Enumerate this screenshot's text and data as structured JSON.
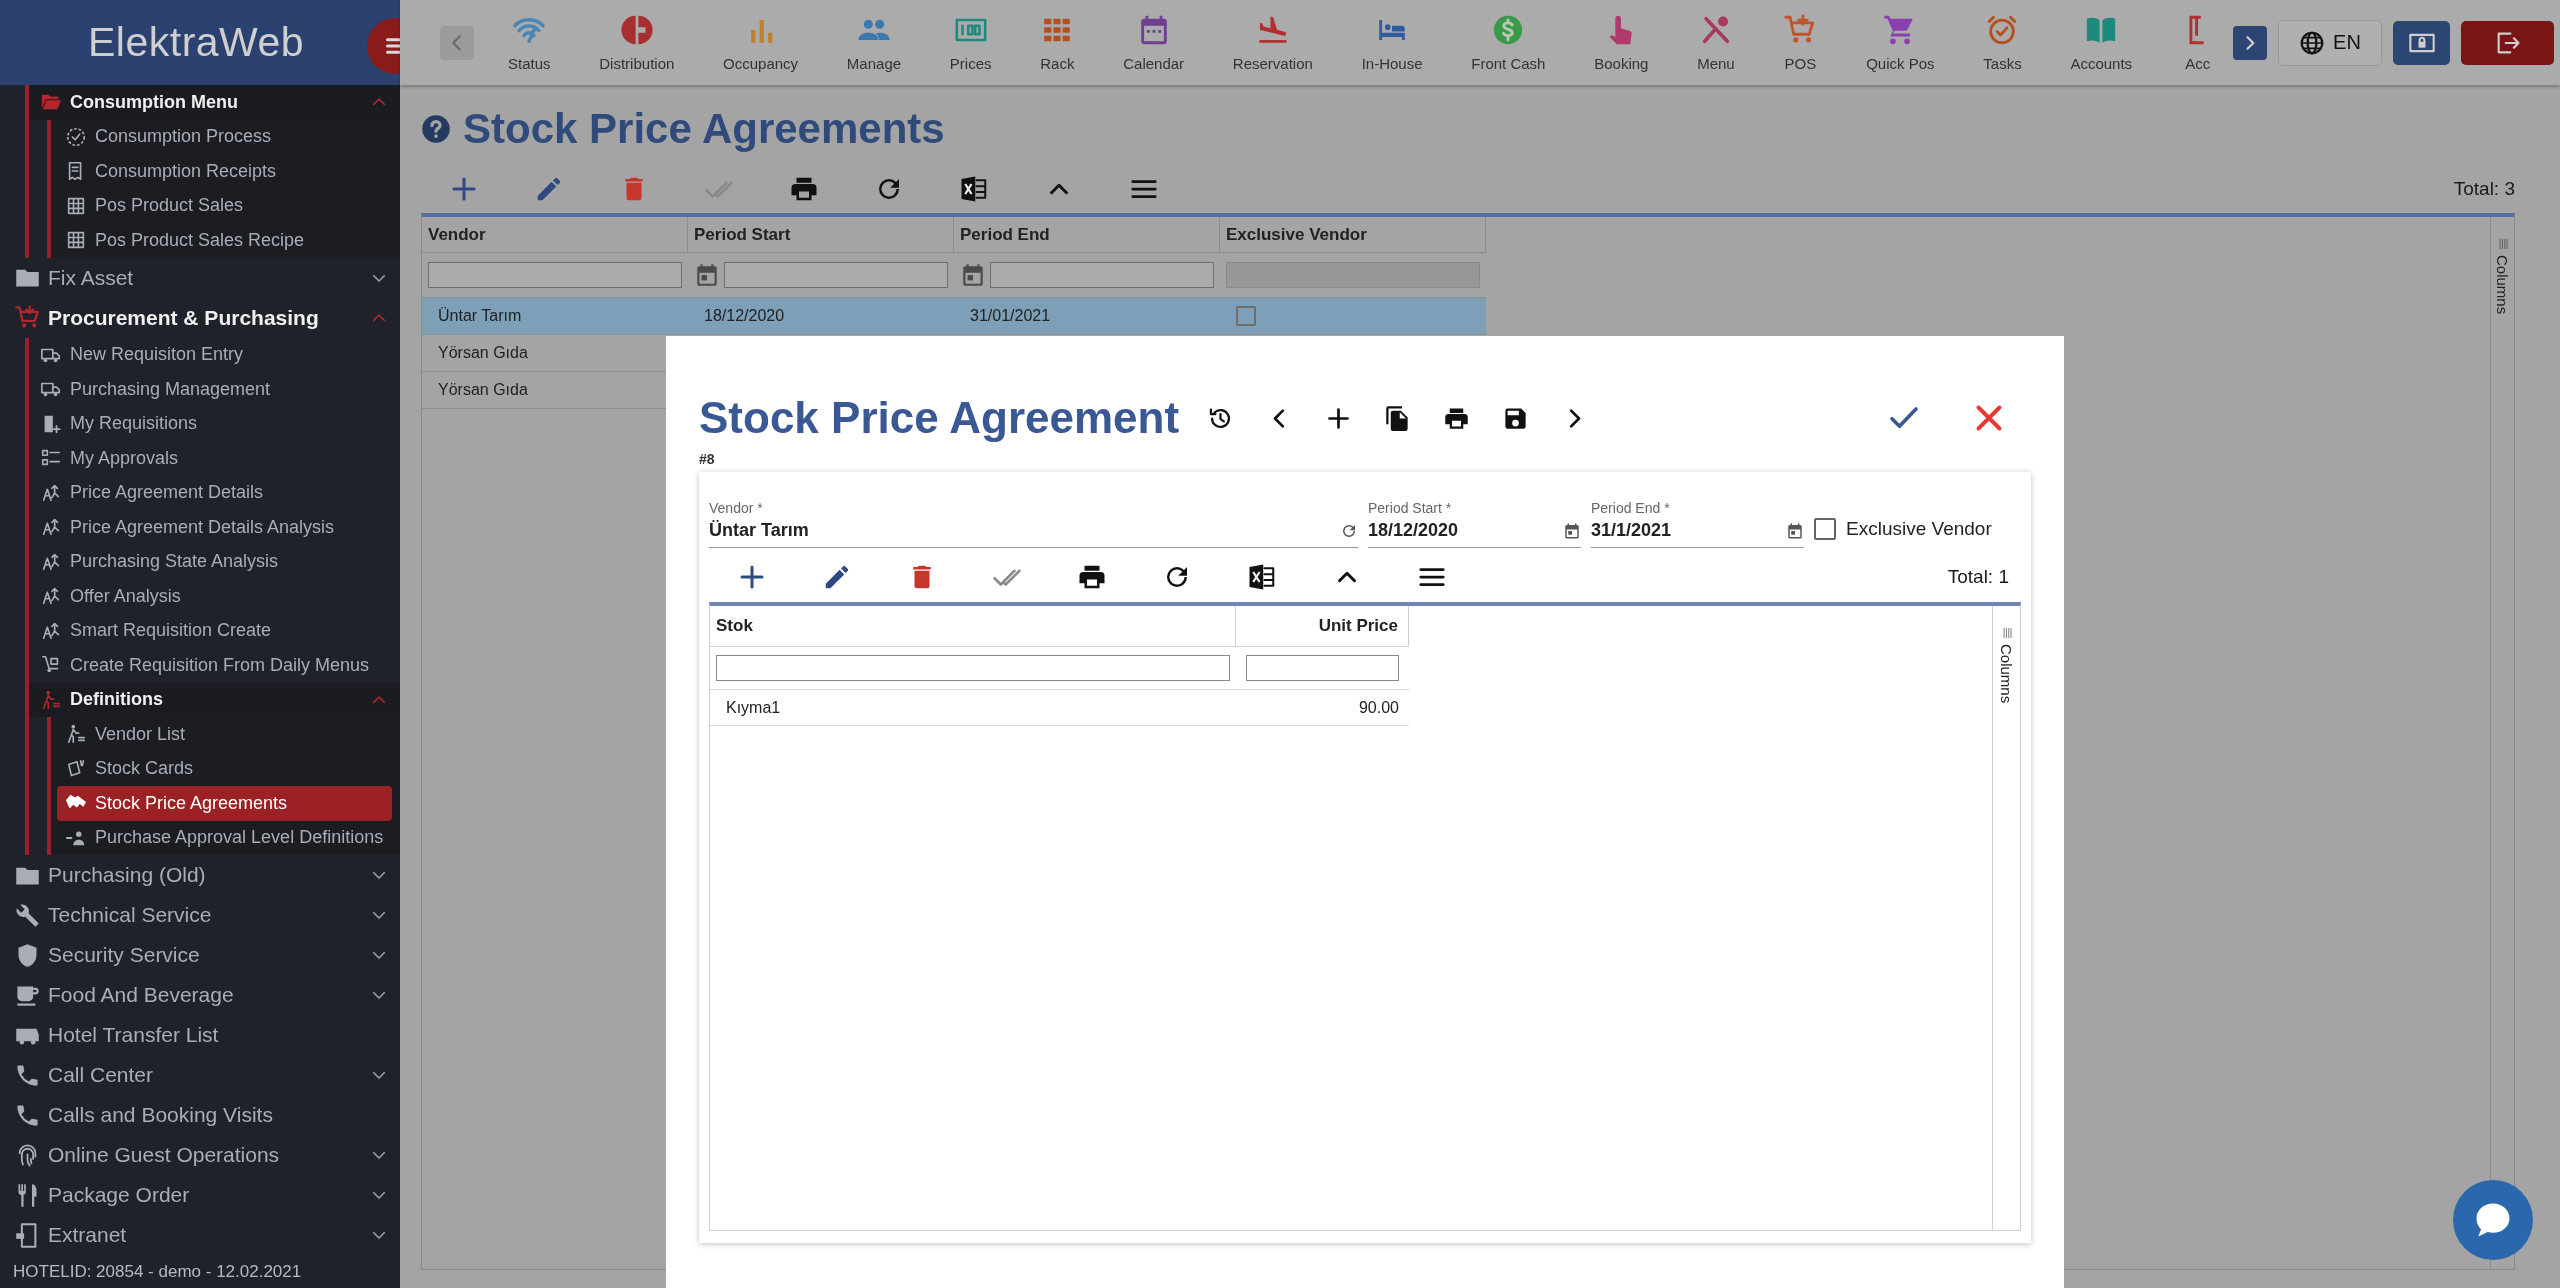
{
  "sidebar": {
    "logo": "ElektraWeb",
    "continued_items": [
      {
        "label": "Consumption Menu",
        "kind": "group",
        "expanded": true,
        "children": [
          {
            "label": "Consumption Process",
            "kind": "link",
            "selected": false
          },
          {
            "label": "Consumption Receipts",
            "kind": "link",
            "selected": false
          },
          {
            "label": "Pos Product Sales",
            "kind": "link",
            "selected": false
          },
          {
            "label": "Pos Product Sales Recipe",
            "kind": "link",
            "selected": false
          }
        ]
      }
    ],
    "items": [
      {
        "label": "Fix Asset",
        "kind": "group",
        "expanded": false
      },
      {
        "label": "Procurement & Purchasing",
        "kind": "group",
        "expanded": true,
        "children": [
          {
            "label": "New Requisiton Entry",
            "kind": "link",
            "selected": false
          },
          {
            "label": "Purchasing Management",
            "kind": "link",
            "selected": false
          },
          {
            "label": "My Requisitions",
            "kind": "link",
            "selected": false
          },
          {
            "label": "My Approvals",
            "kind": "link",
            "selected": false
          },
          {
            "label": "Price Agreement Details",
            "kind": "link",
            "selected": false
          },
          {
            "label": "Price Agreement Details Analysis",
            "kind": "link",
            "selected": false
          },
          {
            "label": "Purchasing State Analysis",
            "kind": "link",
            "selected": false
          },
          {
            "label": "Offer Analysis",
            "kind": "link",
            "selected": false
          },
          {
            "label": "Smart Requisition Create",
            "kind": "link",
            "selected": false
          },
          {
            "label": "Create Requisition From Daily Menus",
            "kind": "link",
            "selected": false
          },
          {
            "label": "Definitions",
            "kind": "group",
            "expanded": true,
            "children": [
              {
                "label": "Vendor List",
                "kind": "link",
                "selected": false
              },
              {
                "label": "Stock Cards",
                "kind": "link",
                "selected": false
              },
              {
                "label": "Stock Price Agreements",
                "kind": "link",
                "selected": true
              },
              {
                "label": "Purchase Approval Level Definitions",
                "kind": "link",
                "selected": false
              }
            ]
          }
        ]
      },
      {
        "label": "Purchasing (Old)",
        "kind": "group",
        "expanded": false
      },
      {
        "label": "Technical Service",
        "kind": "group",
        "expanded": false
      },
      {
        "label": "Security Service",
        "kind": "group",
        "expanded": false
      },
      {
        "label": "Food And Beverage",
        "kind": "group",
        "expanded": false
      },
      {
        "label": "Hotel Transfer List",
        "kind": "link",
        "selected": false
      },
      {
        "label": "Call Center",
        "kind": "group",
        "expanded": false
      },
      {
        "label": "Calls and Booking Visits",
        "kind": "link",
        "selected": false
      },
      {
        "label": "Online Guest Operations",
        "kind": "group",
        "expanded": false
      },
      {
        "label": "Package Order",
        "kind": "group",
        "expanded": false
      },
      {
        "label": "Extranet",
        "kind": "group",
        "expanded": false
      }
    ],
    "footer": "HOTELID: 20854 - demo - 12.02.2021"
  },
  "top_nav": {
    "items": [
      {
        "label": "Status",
        "color": "#4a86b5"
      },
      {
        "label": "Distribution",
        "color": "#a82f2f"
      },
      {
        "label": "Occupancy",
        "color": "#c0802a"
      },
      {
        "label": "Manage",
        "color": "#3a78b0"
      },
      {
        "label": "Prices",
        "color": "#1c8a7c"
      },
      {
        "label": "Rack",
        "color": "#b5501e"
      },
      {
        "label": "Calendar",
        "color": "#6e3f90"
      },
      {
        "label": "Reservation",
        "color": "#b02f2f"
      },
      {
        "label": "In-House",
        "color": "#2f5ba0"
      },
      {
        "label": "Front Cash",
        "color": "#3a9a4a"
      },
      {
        "label": "Booking",
        "color": "#b03a6a"
      },
      {
        "label": "Menu",
        "color": "#a83a60"
      },
      {
        "label": "POS",
        "color": "#c0552a"
      },
      {
        "label": "Quick Pos",
        "color": "#8a3fb0"
      },
      {
        "label": "Tasks",
        "color": "#b5501e"
      },
      {
        "label": "Accounts",
        "color": "#1c8a7c"
      },
      {
        "label": "Acc",
        "color": "#b02f2f"
      }
    ],
    "language": "EN"
  },
  "page": {
    "title": "Stock Price Agreements",
    "total": "Total: 3",
    "table": {
      "columns": [
        {
          "label": "Vendor",
          "kind": "text"
        },
        {
          "label": "Period Start",
          "kind": "date"
        },
        {
          "label": "Period End",
          "kind": "date"
        },
        {
          "label": "Exclusive Vendor",
          "kind": "boolean"
        }
      ],
      "rows": [
        {
          "cells": [
            "Üntar Tarım",
            "18/12/2020",
            "31/01/2021"
          ],
          "exclusive_vendor": false,
          "selected": true
        },
        {
          "cells": [
            "Yörsan Gıda"
          ],
          "selected": false
        },
        {
          "cells": [
            "Yörsan Gıda"
          ],
          "selected": false
        }
      ]
    },
    "columns_panel": "Columns"
  },
  "dialog": {
    "title": "Stock Price Agreement",
    "record": "#8",
    "vendor": {
      "label": "Vendor *",
      "value": "Üntar Tarım"
    },
    "period_start": {
      "label": "Period Start *",
      "value": "18/12/2020"
    },
    "period_end": {
      "label": "Period End *",
      "value": "31/1/2021"
    },
    "exclusive_vendor": {
      "label": "Exclusive Vendor",
      "checked": false
    },
    "total": "Total: 1",
    "table": {
      "columns": [
        {
          "label": "Stok",
          "kind": "text"
        },
        {
          "label": "Unit Price",
          "kind": "number"
        }
      ],
      "rows": [
        {
          "cells": [
            "Kıyma1",
            "90.00"
          ],
          "selected": false
        }
      ]
    },
    "columns_panel": "Columns"
  }
}
